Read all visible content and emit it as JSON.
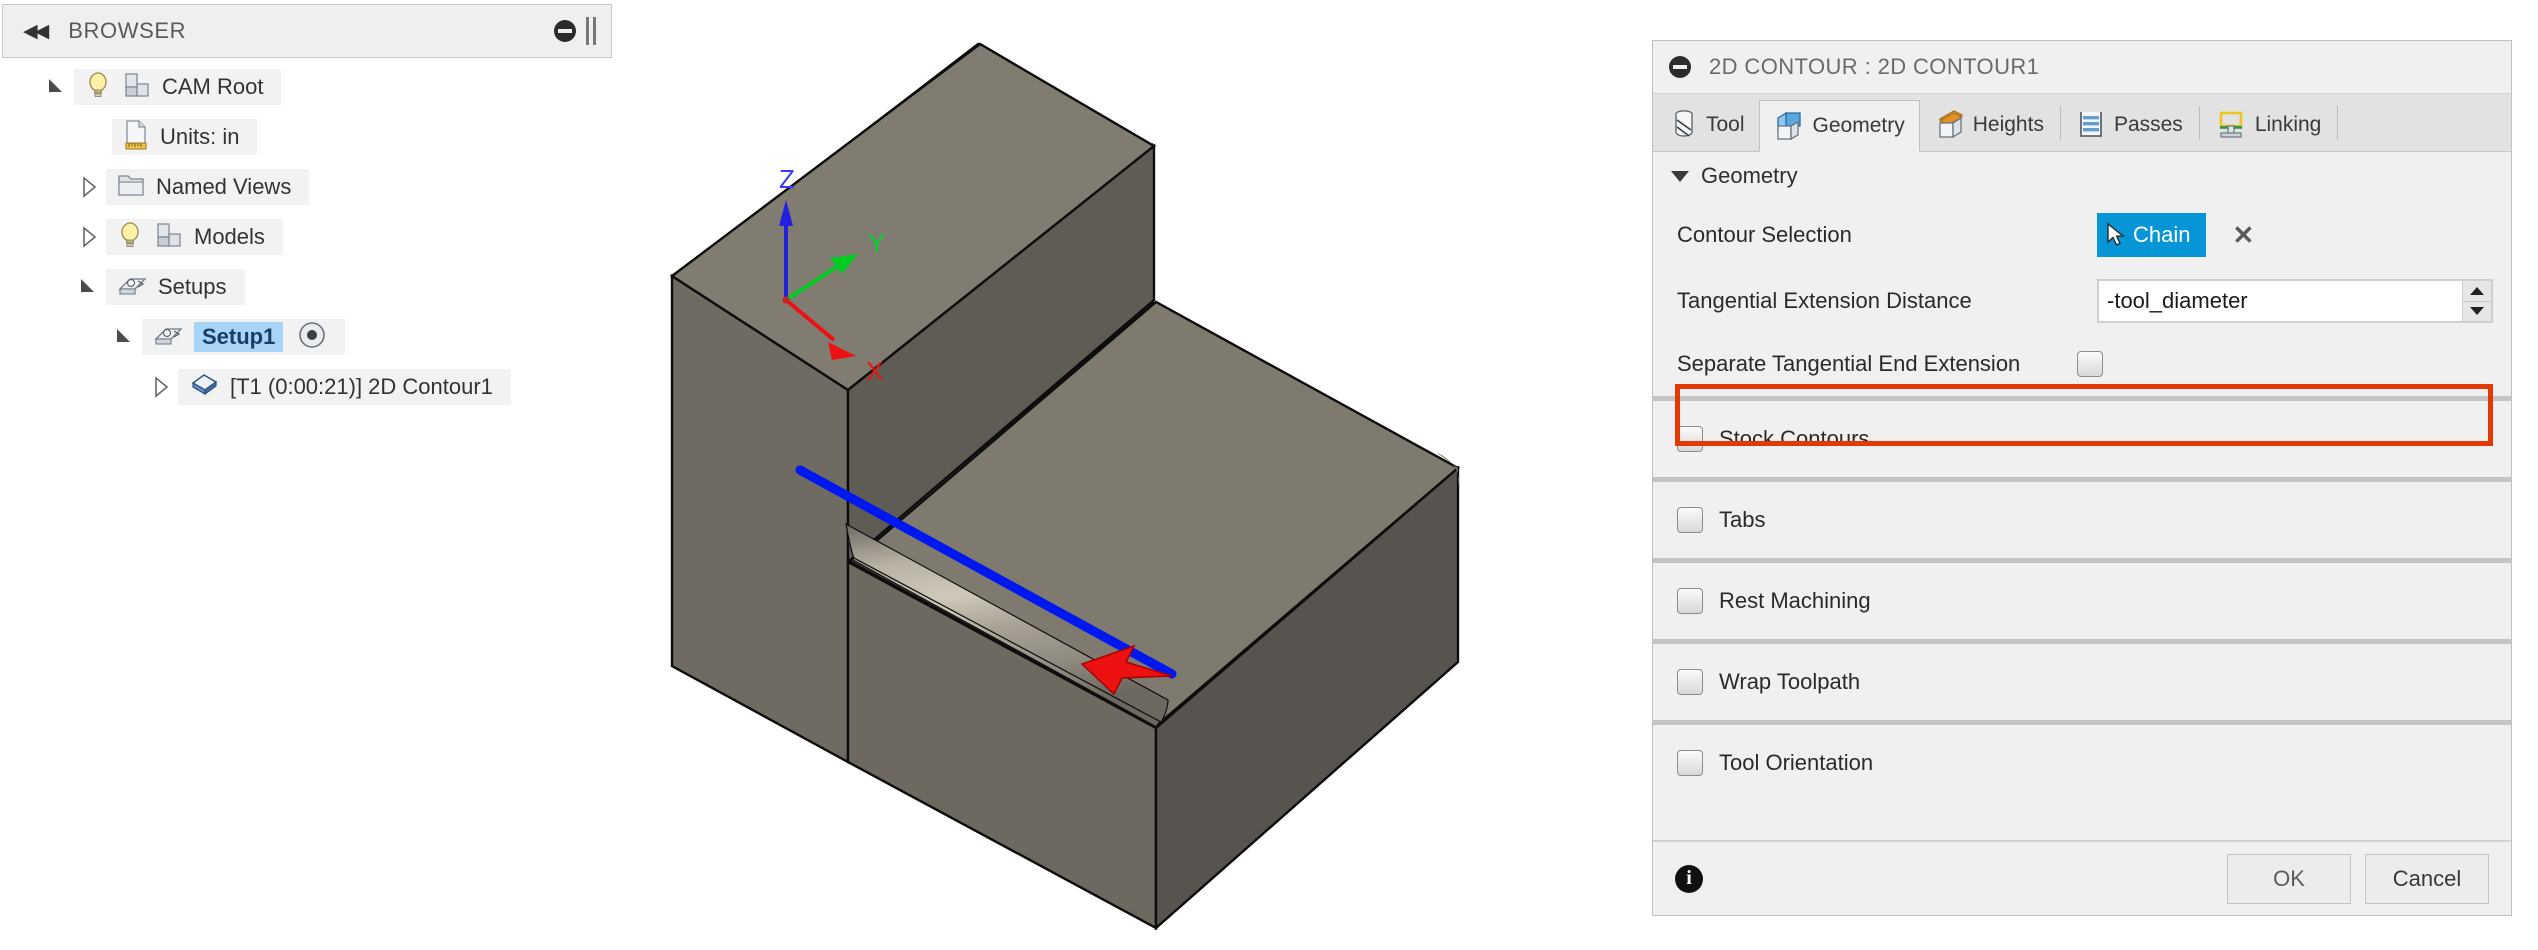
{
  "browser": {
    "title": "BROWSER",
    "collapse_glyph": "◀◀",
    "tree": [
      {
        "label": "CAM Root",
        "state": "open",
        "icons": [
          "bulb-icon",
          "model-cube-icon"
        ],
        "indent": 0,
        "selected": false
      },
      {
        "label": "Units: in",
        "state": "none",
        "icons": [
          "units-document-icon"
        ],
        "indent": 1,
        "selected": false
      },
      {
        "label": "Named Views",
        "state": "closed",
        "icons": [
          "folder-icon"
        ],
        "indent": 1,
        "selected": false
      },
      {
        "label": "Models",
        "state": "closed",
        "icons": [
          "bulb-icon",
          "model-cube-icon"
        ],
        "indent": 1,
        "selected": false
      },
      {
        "label": "Setups",
        "state": "open",
        "icons": [
          "setup-icon"
        ],
        "indent": 1,
        "selected": false
      },
      {
        "label": "Setup1",
        "state": "open",
        "icons": [
          "setup-icon"
        ],
        "indent": 2,
        "selected": true,
        "badge": "active-target-icon"
      },
      {
        "label": "[T1 (0:00:21)] 2D Contour1",
        "state": "closed",
        "icons": [
          "operation-icon"
        ],
        "indent": 3,
        "selected": false
      }
    ]
  },
  "viewport": {
    "axes": {
      "x": "X",
      "y": "Y",
      "z": "Z"
    },
    "x_color": "#ee1111",
    "y_color": "#00cc22",
    "z_color": "#2222dd",
    "selected_edge_color": "#0018f0",
    "direction_arrow_color": "#ee1111",
    "body_color": "#7d7a70"
  },
  "dialog": {
    "title": "2D CONTOUR : 2D CONTOUR1",
    "tabs": [
      {
        "label": "Tool",
        "icon": "endmill-icon",
        "active": false
      },
      {
        "label": "Geometry",
        "icon": "blue-box-icon",
        "active": true
      },
      {
        "label": "Heights",
        "icon": "orange-box-icon",
        "active": false
      },
      {
        "label": "Passes",
        "icon": "striped-box-icon",
        "active": false
      },
      {
        "label": "Linking",
        "icon": "linking-box-icon",
        "active": false
      }
    ],
    "group": {
      "label": "Geometry"
    },
    "contour_selection": {
      "label": "Contour Selection",
      "button_label": "Chain",
      "button_color": "#0696d7",
      "clear_glyph": "✕"
    },
    "tangential": {
      "label": "Tangential Extension Distance",
      "value": "-tool_diameter",
      "placeholder": "",
      "highlight_color": "#e23a05"
    },
    "separate_end_extension": {
      "label": "Separate Tangential End Extension",
      "checked": false
    },
    "sections": [
      {
        "label": "Stock Contours",
        "checked": false
      },
      {
        "label": "Tabs",
        "checked": false
      },
      {
        "label": "Rest Machining",
        "checked": false
      },
      {
        "label": "Wrap Toolpath",
        "checked": false
      },
      {
        "label": "Tool Orientation",
        "checked": false
      }
    ],
    "footer": {
      "info_glyph": "i",
      "ok_label": "OK",
      "cancel_label": "Cancel"
    }
  }
}
